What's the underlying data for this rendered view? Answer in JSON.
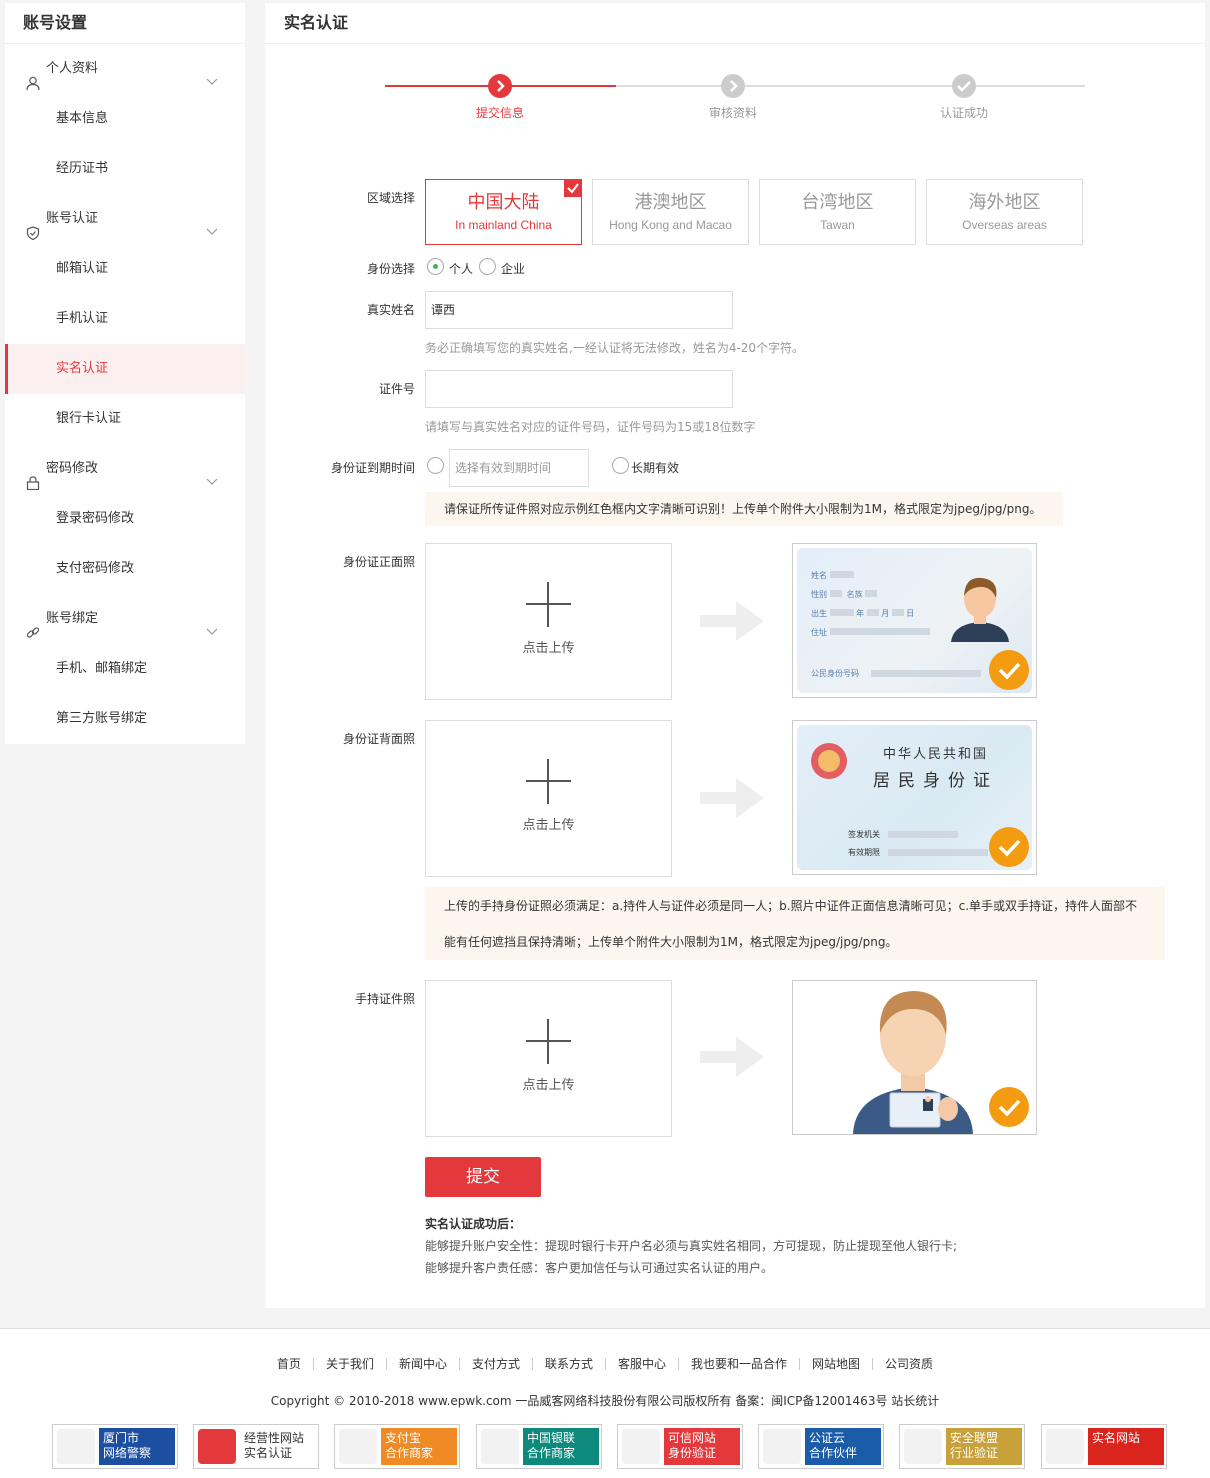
{
  "sidebar": {
    "title": "账号设置",
    "items": [
      {
        "type": "group",
        "label": "个人资料",
        "icon": "user-icon"
      },
      {
        "type": "sub",
        "label": "基本信息"
      },
      {
        "type": "sub",
        "label": "经历证书"
      },
      {
        "type": "group",
        "label": "账号认证",
        "icon": "shield-icon"
      },
      {
        "type": "sub",
        "label": "邮箱认证"
      },
      {
        "type": "sub",
        "label": "手机认证"
      },
      {
        "type": "sub",
        "label": "实名认证",
        "active": true
      },
      {
        "type": "sub",
        "label": "银行卡认证"
      },
      {
        "type": "group",
        "label": "密码修改",
        "icon": "lock-icon"
      },
      {
        "type": "sub",
        "label": "登录密码修改"
      },
      {
        "type": "sub",
        "label": "支付密码修改"
      },
      {
        "type": "group",
        "label": "账号绑定",
        "icon": "link-icon"
      },
      {
        "type": "sub",
        "label": "手机、邮箱绑定"
      },
      {
        "type": "sub",
        "label": "第三方账号绑定"
      }
    ]
  },
  "main": {
    "title": "实名认证",
    "steps": [
      "提交信息",
      "审核资料",
      "认证成功"
    ],
    "current_step": 1,
    "region_label": "区域选择",
    "regions": [
      {
        "name": "中国大陆",
        "en": "In mainland China",
        "selected": true
      },
      {
        "name": "港澳地区",
        "en": "Hong Kong and Macao"
      },
      {
        "name": "台湾地区",
        "en": "Tawan"
      },
      {
        "name": "海外地区",
        "en": "Overseas areas"
      }
    ],
    "identity_label": "身份选择",
    "identity_options": [
      "个人",
      "企业"
    ],
    "name_label": "真实姓名",
    "name_value": "谭西",
    "name_hint": "务必正确填写您的真实姓名,一经认证将无法修改，姓名为4-20个字符。",
    "idno_label": "证件号",
    "idno_value": "",
    "idno_hint": "请填写与真实姓名对应的证件号码，证件号码为15或18位数字",
    "expiry_label": "身份证到期时间",
    "expiry_placeholder": "选择有效到期时间",
    "long_term": "长期有效",
    "notice1": "请保证所传证件照对应示例红色框内文字清晰可识别！上传单个附件大小限制为1M，格式限定为jpeg/jpg/png。",
    "front_label": "身份证正面照",
    "back_label": "身份证背面照",
    "hold_label": "手持证件照",
    "upload_text": "点击上传",
    "notice2_line1": "上传的手持身份证照必须满足：a.持件人与证件必须是同一人；b.照片中证件正面信息清晰可见；c.单手或双手持证，持件人面部不",
    "notice2_line2": "能有任何遮挡且保持清晰；上传单个附件大小限制为1M，格式限定为jpeg/jpg/png。",
    "card_front": {
      "name": "姓名",
      "gender": "性别",
      "ethnic": "名族",
      "birth": "出生",
      "year": "年",
      "month": "月",
      "day": "日",
      "address": "住址",
      "idno": "公民身份号码"
    },
    "card_back": {
      "title1": "中华人民共和国",
      "title2": "居民身份证",
      "issuer": "签发机关",
      "valid": "有效期限"
    },
    "submit": "提交",
    "after_title": "实名认证成功后：",
    "after_line1": "能够提升账户安全性：提现时银行卡开户名必须与真实姓名相同，方可提现，防止提现至他人银行卡;",
    "after_line2": "能够提升客户责任感：客户更加信任与认可通过实名认证的用户。"
  },
  "footer": {
    "links": [
      "首页",
      "关于我们",
      "新闻中心",
      "支付方式",
      "联系方式",
      "客服中心",
      "我也要和一品合作",
      "网站地图",
      "公司资质"
    ],
    "copyright": "Copyright © 2010-2018 www.epwk.com 一品威客网络科技股份有限公司版权所有 备案：闽ICP备12001463号   站长统计",
    "badges": [
      {
        "l1": "厦门市",
        "l2": "网络警察",
        "color": "#1c4fa0"
      },
      {
        "l1": "经营性网站",
        "l2": "实名认证",
        "color": "#ffffff"
      },
      {
        "l1": "支付宝",
        "l2": "合作商家",
        "color": "#f08a24"
      },
      {
        "l1": "中国银联",
        "l2": "合作商家",
        "color": "#0e8a7c"
      },
      {
        "l1": "可信网站",
        "l2": "身份验证",
        "color": "#e4393c"
      },
      {
        "l1": "公证云",
        "l2": "合作伙伴",
        "color": "#1a5ca8"
      },
      {
        "l1": "安全联盟",
        "l2": "行业验证",
        "color": "#c9a13a"
      },
      {
        "l1": "实名网站",
        "l2": "",
        "color": "#d9251d"
      }
    ]
  }
}
